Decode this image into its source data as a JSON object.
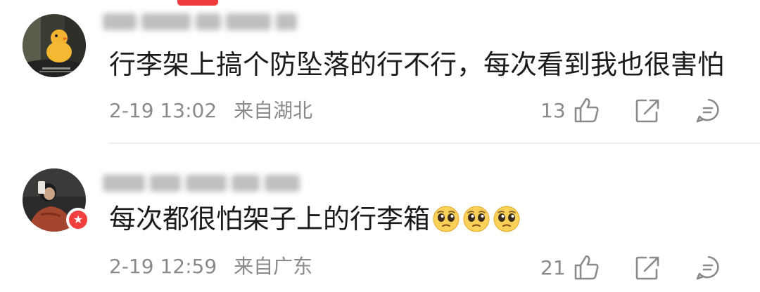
{
  "comments": [
    {
      "content": "行李架上搞个防坠落的行不行，每次看到我也很害怕",
      "date": "2-19 13:02",
      "location": "来自湖北",
      "likes": "13",
      "emoji": [],
      "avatar_badge": false
    },
    {
      "content": "每次都很怕架子上的行李箱",
      "date": "2-19 12:59",
      "location": "来自广东",
      "likes": "21",
      "emoji": [
        "pleading-face-icon",
        "pleading-face-icon",
        "pleading-face-icon"
      ],
      "avatar_badge": true,
      "badge_symbol": "★"
    }
  ],
  "colors": {
    "meta_text": "#8a8a8a",
    "badge": "#ef3f3f",
    "top_marker": "#ef3b3b",
    "emoji_face": "#fcd15a"
  }
}
